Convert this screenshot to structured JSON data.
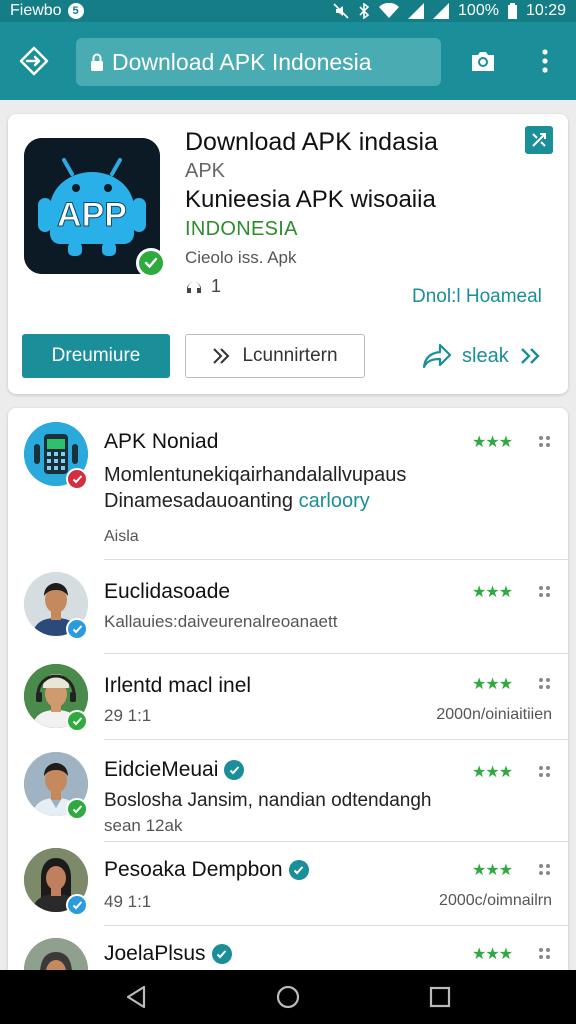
{
  "status_bar": {
    "carrier": "Fiewbo",
    "badge": "5",
    "battery": "100%",
    "time": "10:29"
  },
  "toolbar": {
    "url": "Download APK Indonesia",
    "back_icon": "diamond-arrow-icon",
    "camera_icon": "camera-icon",
    "menu_icon": "overflow-menu-icon"
  },
  "app": {
    "title": "Download APK indasia",
    "subtitle": "APK",
    "name": "Kunieesia APK wisoaiia",
    "country": "INDONESIA",
    "developer": "Cieolo iss. Apk",
    "count": "1",
    "home_link": "Dnol:l Hoameal",
    "icon_text": "APP",
    "premium_button": "Dreumiure",
    "launch_button": "Lcunnirtern",
    "steak_button": "sleak",
    "colors": {
      "accent": "#1a8e99",
      "verified": "#2eaa3e"
    }
  },
  "list": {
    "items": [
      {
        "name": "APK Noniad",
        "line1": "Momlentunekiqairhandalallvupaus",
        "line2_prefix": "Dinamesadauoanting",
        "line2_link": "carloory",
        "meta": "Aisla",
        "right_meta": "",
        "stars": "★★★",
        "verified": false
      },
      {
        "name": "Euclidasoade",
        "line1": "",
        "meta": "Kallauies:daiveurenalreoanaett",
        "right_meta": "",
        "stars": "★★★",
        "verified": false
      },
      {
        "name": "Irlentd macl inel",
        "line1": "",
        "meta": "29 1:1",
        "right_meta": "2000n/oiniaitiien",
        "stars": "★★★",
        "verified": false
      },
      {
        "name": "EidcieMeuai",
        "line1": "Boslosha Jansim, nandian odtendangh",
        "meta": "sean 12ak",
        "right_meta": "",
        "stars": "★★★",
        "verified": true
      },
      {
        "name": "Pesoaka Dempbon",
        "line1": "",
        "meta": "49 1:1",
        "right_meta": "2000c/oimnailrn",
        "stars": "★★★",
        "verified": true
      },
      {
        "name": "JoelaPlsus",
        "line1": "",
        "meta": "",
        "right_meta": "",
        "stars": "★★★",
        "verified": true
      }
    ]
  },
  "nav": {
    "back_icon": "triangle-back-icon",
    "home_icon": "circle-home-icon",
    "recents_icon": "square-recents-icon"
  }
}
